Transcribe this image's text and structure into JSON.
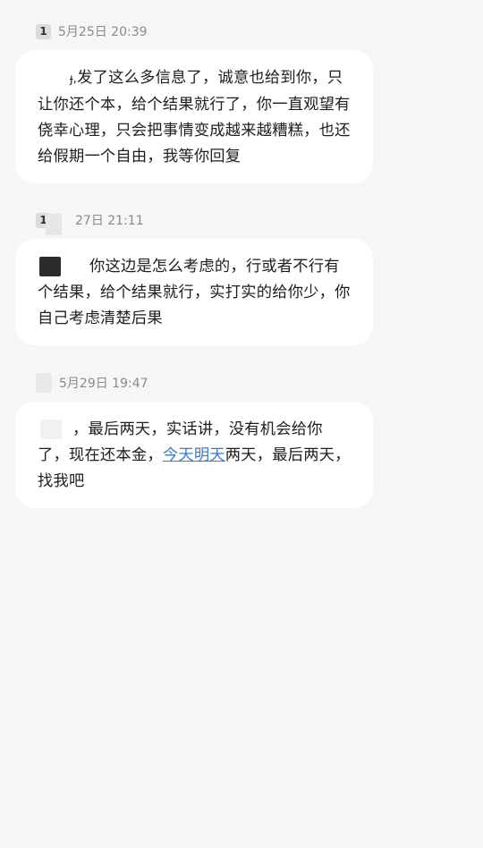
{
  "messages": [
    {
      "sim": "1",
      "time": "5月25日 20:39",
      "prefix": "ɟ,",
      "body": "发了这么多信息了，诚意也给到你，只让你还个本，给个结果就行了，你一直观望有侥幸心理，只会把事情变成越来越糟糕，也还给假期一个自由，我等你回复"
    },
    {
      "sim": "1",
      "time": "27日 21:11",
      "body": "你这边是怎么考虑的，行或者不行有个结果，给个结果就行，实打实的给你少，你自己考虑清楚后果"
    },
    {
      "sim": "",
      "time": "5月29日 19:47",
      "body_before_link": "，最后两天，实话讲，没有机会给你了，现在还本金，",
      "link_text": "今天明天",
      "body_after_link": "两天，最后两天，找我吧"
    }
  ]
}
